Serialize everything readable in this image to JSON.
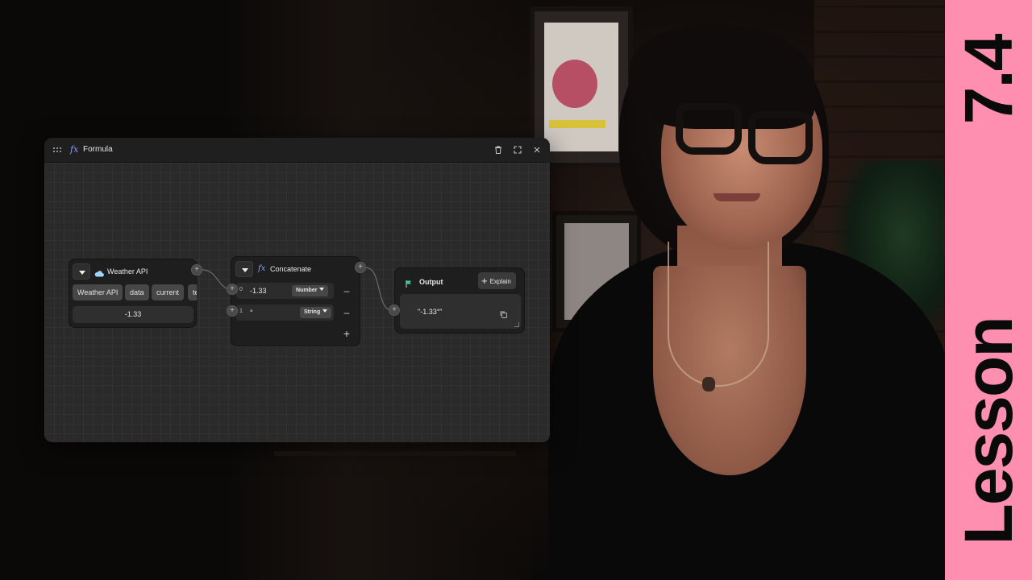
{
  "formula_window": {
    "title": "Formula",
    "icons": {
      "grip": "drag-handle-icon",
      "fx": "function-icon",
      "delete": "trash-icon",
      "expand": "expand-icon",
      "close": "close-icon"
    }
  },
  "nodes": {
    "weather": {
      "title": "Weather API",
      "icon": "cloud-icon",
      "path_chips": [
        "Weather API",
        "data",
        "current",
        "te"
      ],
      "value": "-1.33"
    },
    "concatenate": {
      "title": "Concatenate",
      "rows": [
        {
          "index": "0",
          "value": "-1.33",
          "type": "Number"
        },
        {
          "index": "1",
          "value": "°",
          "type": "String"
        }
      ],
      "add_symbol": "+",
      "remove_symbol": "–"
    },
    "output": {
      "title": "Output",
      "icon": "flag-icon",
      "explain_label": "Explain",
      "value": "\"-1.33°\""
    }
  },
  "banner": {
    "word": "Lesson",
    "number": "7.4",
    "color": "#ff8fb1"
  },
  "colors": {
    "accent_fx": "#8a9cff",
    "flag": "#3ecf8e",
    "cloud": "#9fd4ff"
  }
}
